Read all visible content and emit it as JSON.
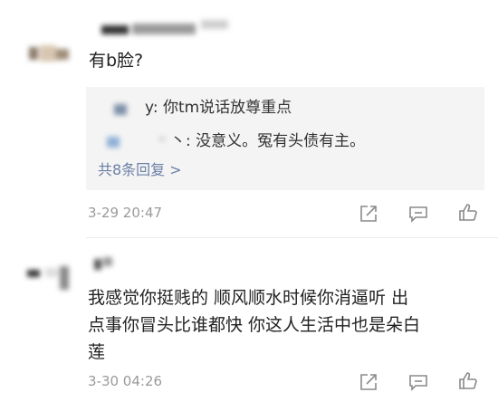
{
  "comments": [
    {
      "text": "有b脸?",
      "time": "3-29 20:47",
      "replies": [
        {
          "text": "y: 你tm说话放尊重点"
        },
        {
          "text": "丶: 没意义。冤有头债有主。"
        }
      ],
      "more_replies": "共8条回复 >"
    },
    {
      "text": "我感觉你挺贱的  顺风顺水时候你消逼听  出\n点事你冒头比谁都快  你这人生活中也是朵白\n莲",
      "time": "3-30 04:26"
    }
  ],
  "icons": {
    "share": "share-icon",
    "comment": "comment-icon",
    "like": "thumbs-up-icon"
  },
  "colors": {
    "link": "#6b7fa6",
    "timestamp": "#9a9a9a",
    "reply_bg": "#f4f4f4"
  }
}
